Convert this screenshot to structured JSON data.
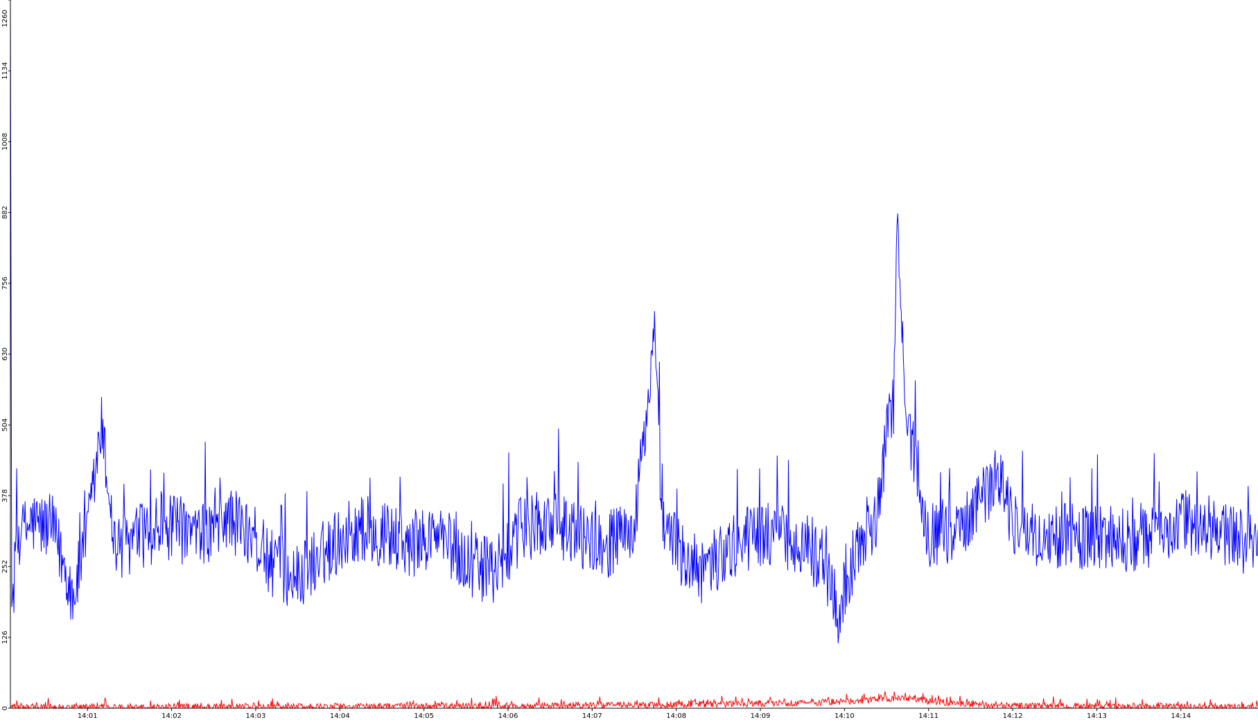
{
  "chart_data": {
    "type": "line",
    "title": "",
    "xlabel": "",
    "ylabel": "",
    "ylim": [
      0,
      1260
    ],
    "y_ticks": [
      "0",
      "126",
      "252",
      "378",
      "504",
      "630",
      "756",
      "882",
      "1008",
      "1134",
      "1260"
    ],
    "x_ticks": [
      "14:01",
      "14:02",
      "14:03",
      "14:04",
      "14:05",
      "14:06",
      "14:07",
      "14:08",
      "14:09",
      "14:10",
      "14:11",
      "14:12",
      "14:13",
      "14:14"
    ],
    "x_range": [
      "14:00:05",
      "14:14:55"
    ],
    "grid": false,
    "legend": "none",
    "series": [
      {
        "color": "#0000ff",
        "keypoints": [
          [
            "14:00:05",
            1260
          ],
          [
            "14:00:06",
            180
          ],
          [
            "14:00:10",
            300
          ],
          [
            "14:00:20",
            330
          ],
          [
            "14:00:35",
            320
          ],
          [
            "14:00:50",
            200
          ],
          [
            "14:01:00",
            310
          ],
          [
            "14:01:10",
            500
          ],
          [
            "14:01:20",
            280
          ],
          [
            "14:01:40",
            310
          ],
          [
            "14:02:00",
            320
          ],
          [
            "14:02:20",
            300
          ],
          [
            "14:02:40",
            340
          ],
          [
            "14:03:00",
            300
          ],
          [
            "14:03:10",
            260
          ],
          [
            "14:03:30",
            230
          ],
          [
            "14:03:50",
            280
          ],
          [
            "14:04:10",
            320
          ],
          [
            "14:04:30",
            310
          ],
          [
            "14:04:50",
            290
          ],
          [
            "14:05:10",
            310
          ],
          [
            "14:05:30",
            260
          ],
          [
            "14:05:50",
            240
          ],
          [
            "14:06:10",
            320
          ],
          [
            "14:06:30",
            330
          ],
          [
            "14:06:50",
            310
          ],
          [
            "14:07:10",
            290
          ],
          [
            "14:07:30",
            320
          ],
          [
            "14:07:45",
            660
          ],
          [
            "14:07:50",
            330
          ],
          [
            "14:08:00",
            290
          ],
          [
            "14:08:15",
            230
          ],
          [
            "14:08:30",
            270
          ],
          [
            "14:08:50",
            300
          ],
          [
            "14:09:10",
            310
          ],
          [
            "14:09:30",
            300
          ],
          [
            "14:09:50",
            230
          ],
          [
            "14:09:55",
            160
          ],
          [
            "14:10:10",
            300
          ],
          [
            "14:10:25",
            350
          ],
          [
            "14:10:32",
            560
          ],
          [
            "14:10:35",
            520
          ],
          [
            "14:10:38",
            880
          ],
          [
            "14:10:41",
            650
          ],
          [
            "14:10:45",
            510
          ],
          [
            "14:10:52",
            430
          ],
          [
            "14:11:00",
            310
          ],
          [
            "14:11:20",
            320
          ],
          [
            "14:11:40",
            380
          ],
          [
            "14:11:50",
            420
          ],
          [
            "14:12:00",
            330
          ],
          [
            "14:12:20",
            300
          ],
          [
            "14:12:40",
            310
          ],
          [
            "14:13:00",
            300
          ],
          [
            "14:13:20",
            300
          ],
          [
            "14:13:40",
            310
          ],
          [
            "14:14:00",
            330
          ],
          [
            "14:14:20",
            320
          ],
          [
            "14:14:40",
            300
          ],
          [
            "14:14:55",
            290
          ]
        ],
        "noise_amplitude": 60
      },
      {
        "color": "#ff0000",
        "keypoints": [
          [
            "14:00:05",
            2
          ],
          [
            "14:05:00",
            3
          ],
          [
            "14:07:45",
            6
          ],
          [
            "14:09:40",
            10
          ],
          [
            "14:10:00",
            12
          ],
          [
            "14:10:50",
            18
          ],
          [
            "14:11:00",
            12
          ],
          [
            "14:12:00",
            4
          ],
          [
            "14:14:55",
            3
          ]
        ],
        "noise_amplitude": 6
      }
    ]
  }
}
